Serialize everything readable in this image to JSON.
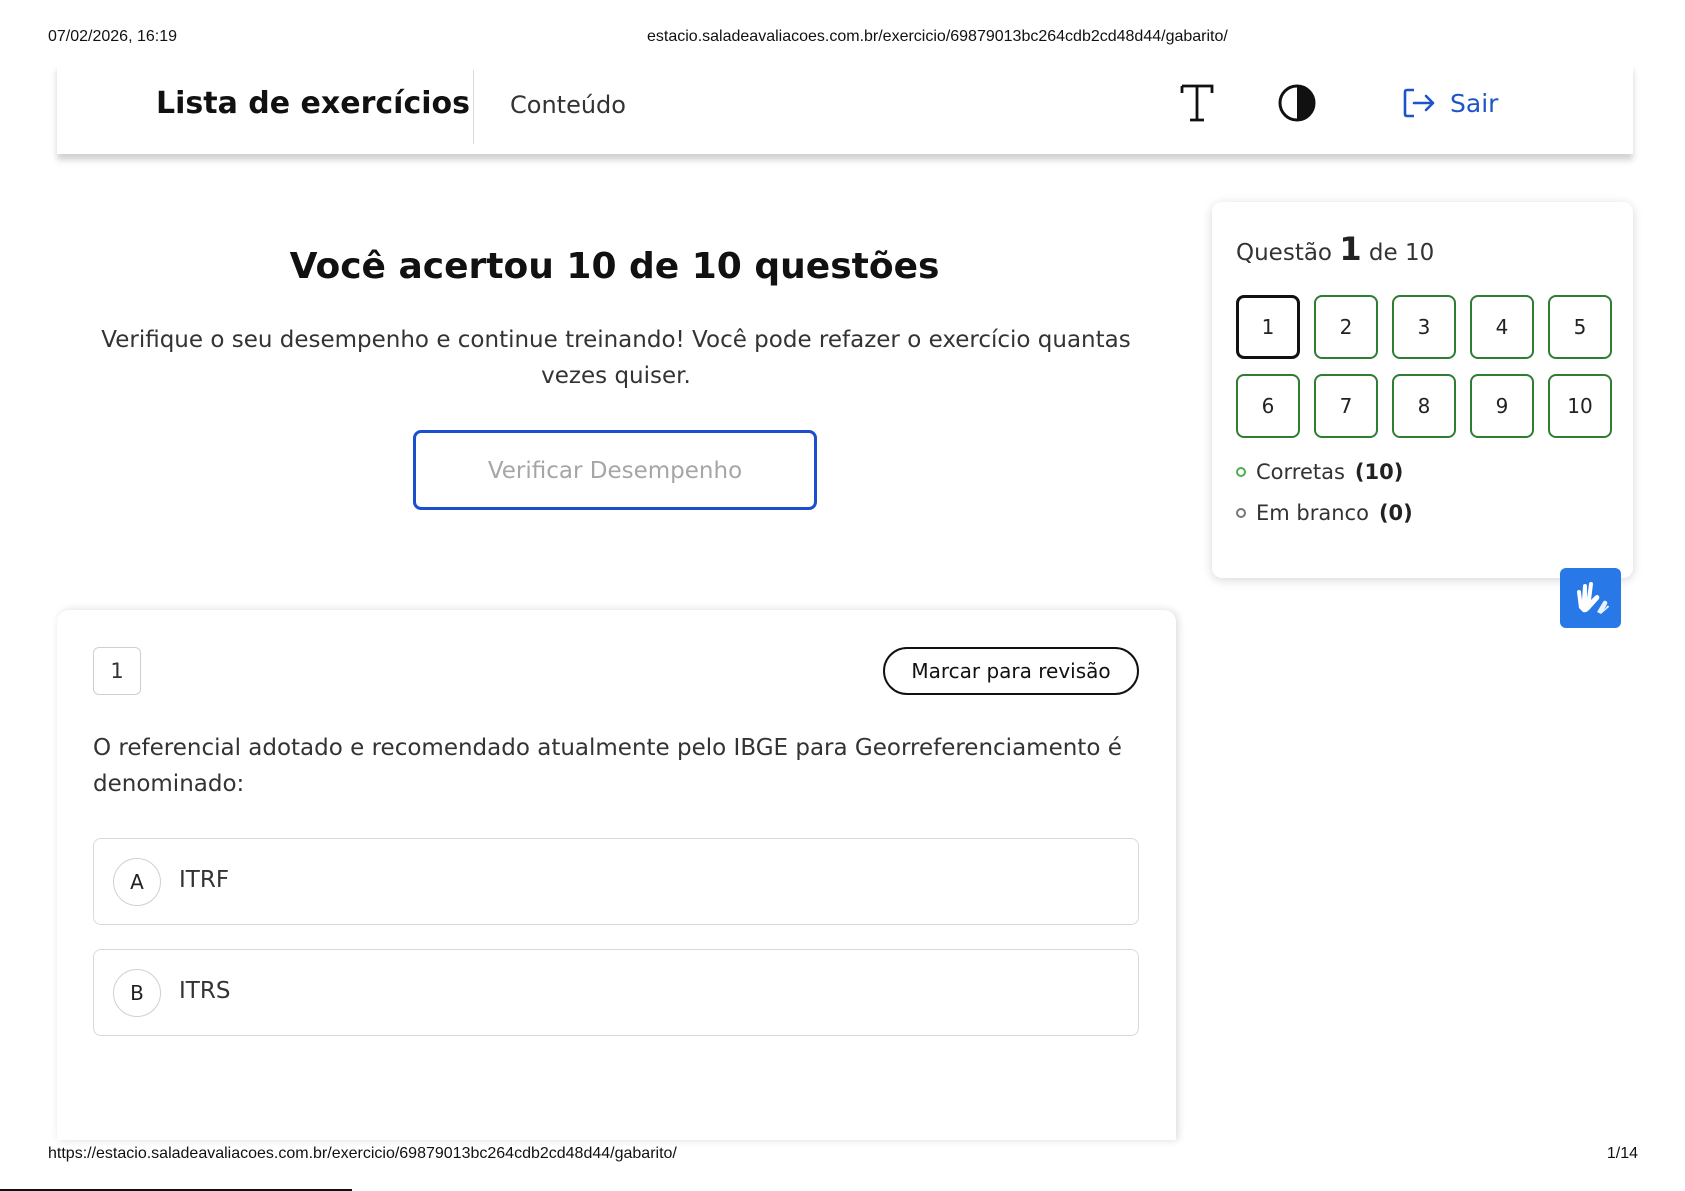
{
  "print": {
    "datetime": "07/02/2026, 16:19",
    "header_url": "estacio.saladeavaliacoes.com.br/exercicio/69879013bc264cdb2cd48d44/gabarito/",
    "footer_url": "https://estacio.saladeavaliacoes.com.br/exercicio/69879013bc264cdb2cd48d44/gabarito/",
    "page": "1/14"
  },
  "header": {
    "title": "Lista de exercícios",
    "nav_content": "Conteúdo",
    "font_icon": "font-size-icon",
    "contrast_icon": "contrast-icon",
    "logout_icon": "logout-icon",
    "logout_label": "Sair"
  },
  "result": {
    "title": "Você acertou 10 de 10 questões",
    "subtitle": "Verifique o seu desempenho e continue treinando! Você pode refazer o exercício quantas vezes quiser.",
    "verify_button": "Verificar Desempenho"
  },
  "navigator": {
    "label_prefix": "Questão",
    "current": "1",
    "label_suffix": "de 10",
    "questions": [
      "1",
      "2",
      "3",
      "4",
      "5",
      "6",
      "7",
      "8",
      "9",
      "10"
    ],
    "legend": {
      "correct_label": "Corretas",
      "correct_count": "(10)",
      "blank_label": "Em branco",
      "blank_count": "(0)"
    }
  },
  "accessibility": {
    "vlibras_icon": "sign-language-hands-icon"
  },
  "question": {
    "number": "1",
    "review_button": "Marcar para revisão",
    "text": "O referencial adotado e recomendado atualmente pelo IBGE para Georreferenciamento é denominado:",
    "options": [
      {
        "letter": "A",
        "text": "ITRF"
      },
      {
        "letter": "B",
        "text": "ITRS"
      }
    ]
  },
  "colors": {
    "accent": "#1d55c8",
    "correct_border": "#2e7d32",
    "vlibras_bg": "#2878e8"
  }
}
